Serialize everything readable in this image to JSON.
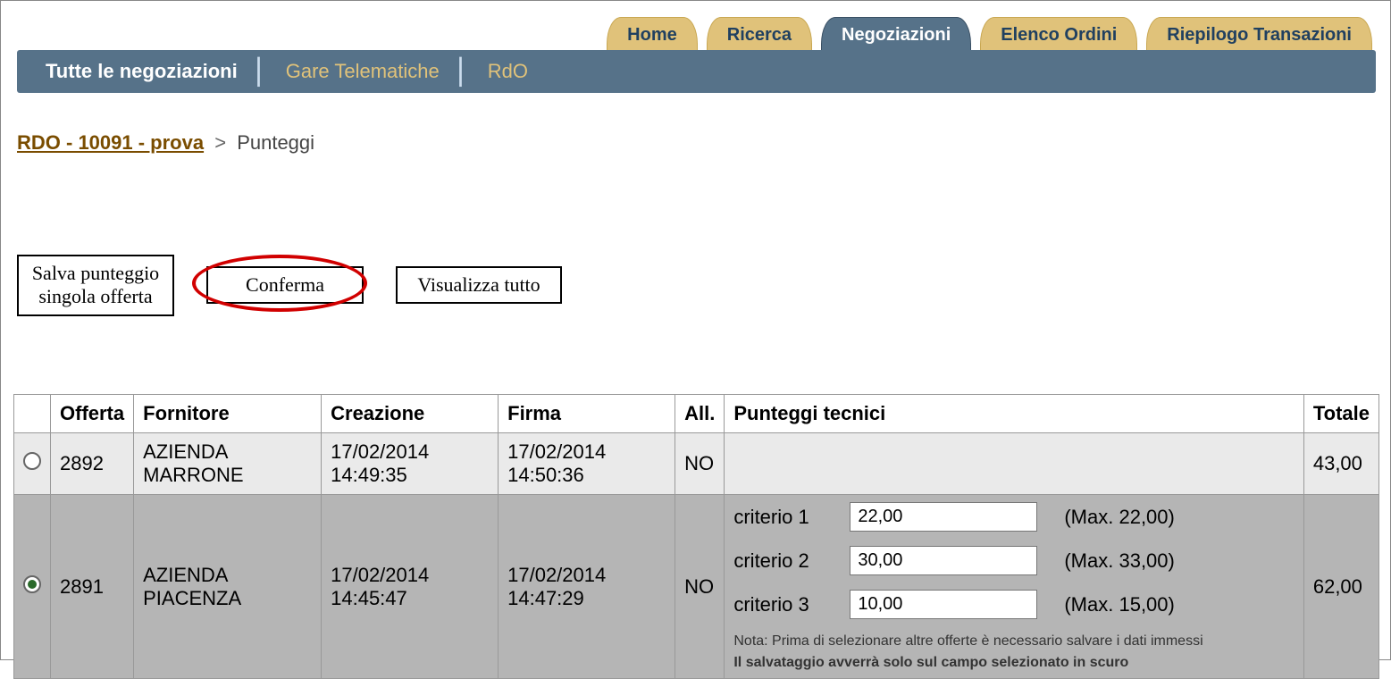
{
  "top_tabs": {
    "home": "Home",
    "ricerca": "Ricerca",
    "negoziazioni": "Negoziazioni",
    "elenco_ordini": "Elenco Ordini",
    "riepilogo": "Riepilogo Transazioni"
  },
  "subnav": {
    "tutte": "Tutte le negoziazioni",
    "gare": "Gare Telematiche",
    "rdo": "RdO"
  },
  "breadcrumb": {
    "link": "RDO - 10091 - prova",
    "separator": ">",
    "current": "Punteggi"
  },
  "buttons": {
    "salva": "Salva punteggio\nsingola offerta",
    "conferma": "Conferma",
    "visualizza": "Visualizza tutto"
  },
  "table": {
    "headers": {
      "select": "",
      "offerta": "Offerta",
      "fornitore": "Fornitore",
      "creazione": "Creazione",
      "firma": "Firma",
      "all": "All.",
      "punteggi": "Punteggi tecnici",
      "totale": "Totale"
    },
    "rows": [
      {
        "selected": false,
        "offerta": "2892",
        "fornitore": "AZIENDA MARRONE",
        "creazione": "17/02/2014 14:49:35",
        "firma": "17/02/2014 14:50:36",
        "allegato": "NO",
        "totale": "43,00"
      },
      {
        "selected": true,
        "offerta": "2891",
        "fornitore": "AZIENDA PIACENZA",
        "creazione": "17/02/2014 14:45:47",
        "firma": "17/02/2014 14:47:29",
        "allegato": "NO",
        "totale": "62,00",
        "criteria": [
          {
            "label": "criterio 1",
            "value": "22,00",
            "max": "(Max. 22,00)"
          },
          {
            "label": "criterio 2",
            "value": "30,00",
            "max": "(Max. 33,00)"
          },
          {
            "label": "criterio 3",
            "value": "10,00",
            "max": "(Max. 15,00)"
          }
        ],
        "note1": "Nota: Prima di selezionare altre offerte è necessario salvare i dati immessi",
        "note2": "Il salvataggio avverrà solo sul campo selezionato in scuro"
      }
    ]
  }
}
